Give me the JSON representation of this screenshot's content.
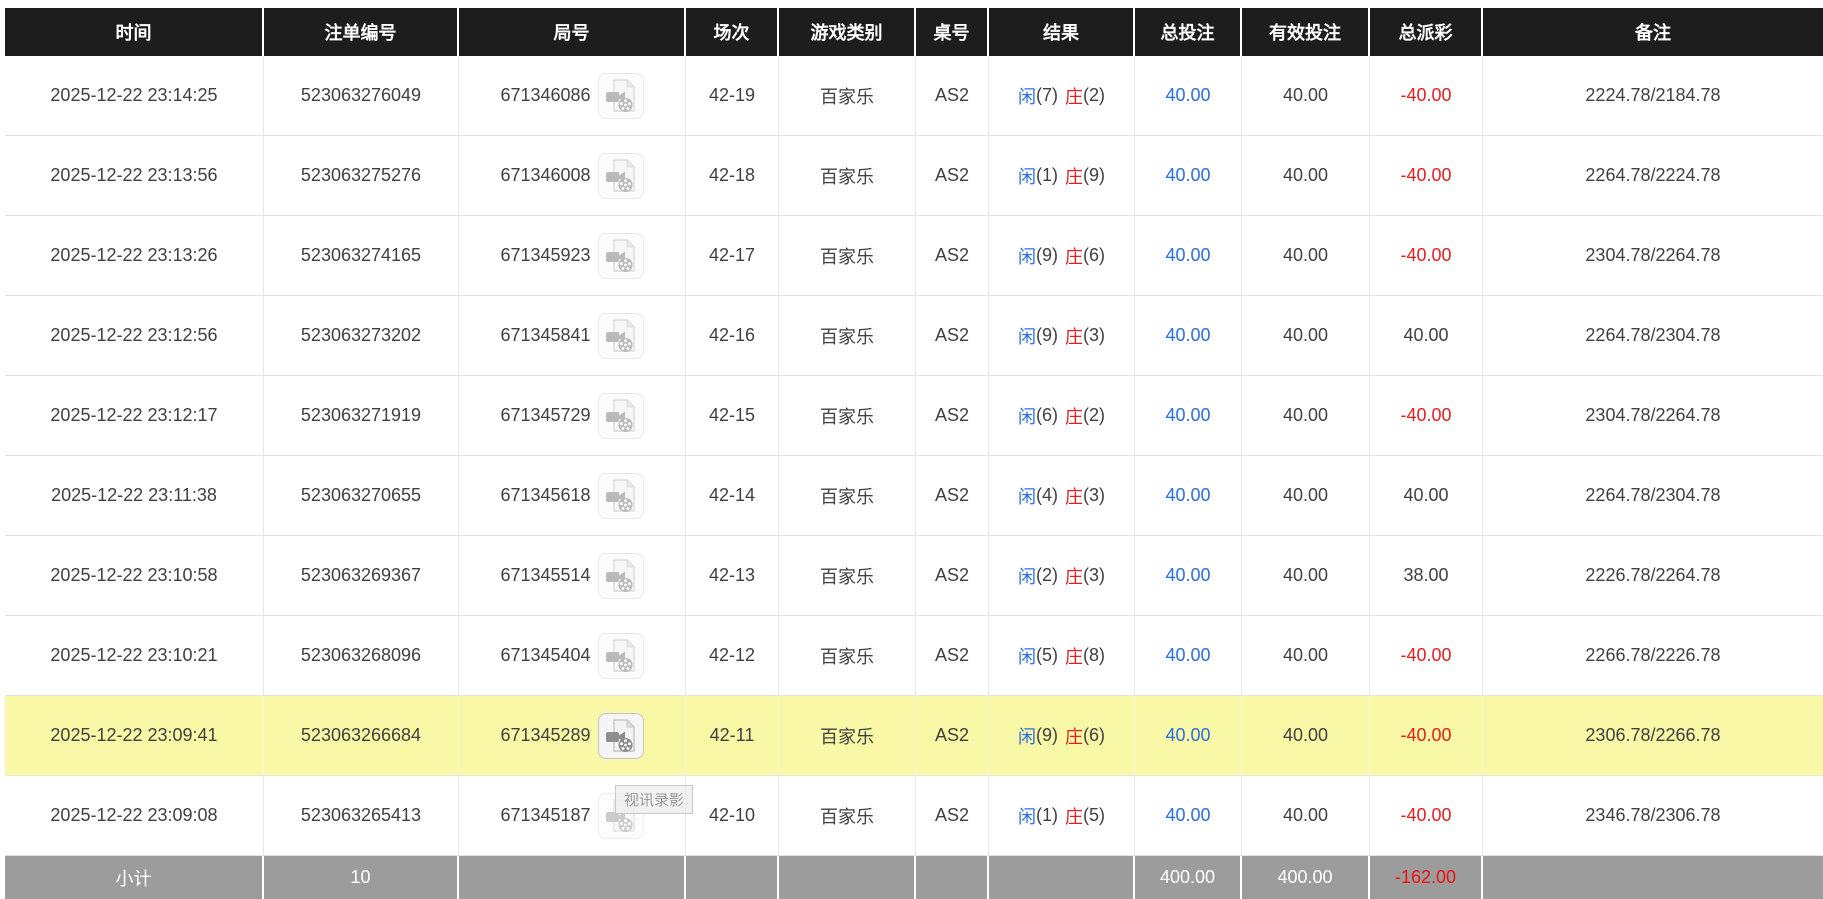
{
  "colors": {
    "header_bg": "#1d1d1d",
    "header_text": "#ffffff",
    "body_text": "#404040",
    "player_blue": "#2b6de0",
    "banker_red": "#dd2020",
    "negative_red": "#dd2020",
    "amount_blue": "#2b6de0",
    "highlight_yellow": "#f8f8a6",
    "footer_bg": "#9c9c9c",
    "row_border": "#e3e3e3"
  },
  "table": {
    "columns": [
      {
        "key": "time",
        "label": "时间"
      },
      {
        "key": "bet_id",
        "label": "注单编号"
      },
      {
        "key": "round_id",
        "label": "局号"
      },
      {
        "key": "session",
        "label": "场次"
      },
      {
        "key": "game_type",
        "label": "游戏类别"
      },
      {
        "key": "table_no",
        "label": "桌号"
      },
      {
        "key": "result",
        "label": "结果"
      },
      {
        "key": "total_bet",
        "label": "总投注"
      },
      {
        "key": "valid_bet",
        "label": "有效投注"
      },
      {
        "key": "payout",
        "label": "总派彩"
      },
      {
        "key": "remark",
        "label": "备注"
      }
    ],
    "rows": [
      {
        "time": "2025-12-22 23:14:25",
        "bet_id": "523063276049",
        "round_id": "671346086",
        "session": "42-19",
        "game_type": "百家乐",
        "table_no": "AS2",
        "result": {
          "player_label": "闲",
          "player_score": "(7)",
          "banker_label": "庄",
          "banker_score": "(2)"
        },
        "total_bet": "40.00",
        "valid_bet": "40.00",
        "payout": "-40.00",
        "remark": "2224.78/2184.78",
        "highlighted": false,
        "show_tooltip": false
      },
      {
        "time": "2025-12-22 23:13:56",
        "bet_id": "523063275276",
        "round_id": "671346008",
        "session": "42-18",
        "game_type": "百家乐",
        "table_no": "AS2",
        "result": {
          "player_label": "闲",
          "player_score": "(1)",
          "banker_label": "庄",
          "banker_score": "(9)"
        },
        "total_bet": "40.00",
        "valid_bet": "40.00",
        "payout": "-40.00",
        "remark": "2264.78/2224.78",
        "highlighted": false,
        "show_tooltip": false
      },
      {
        "time": "2025-12-22 23:13:26",
        "bet_id": "523063274165",
        "round_id": "671345923",
        "session": "42-17",
        "game_type": "百家乐",
        "table_no": "AS2",
        "result": {
          "player_label": "闲",
          "player_score": "(9)",
          "banker_label": "庄",
          "banker_score": "(6)"
        },
        "total_bet": "40.00",
        "valid_bet": "40.00",
        "payout": "-40.00",
        "remark": "2304.78/2264.78",
        "highlighted": false,
        "show_tooltip": false
      },
      {
        "time": "2025-12-22 23:12:56",
        "bet_id": "523063273202",
        "round_id": "671345841",
        "session": "42-16",
        "game_type": "百家乐",
        "table_no": "AS2",
        "result": {
          "player_label": "闲",
          "player_score": "(9)",
          "banker_label": "庄",
          "banker_score": "(3)"
        },
        "total_bet": "40.00",
        "valid_bet": "40.00",
        "payout": "40.00",
        "remark": "2264.78/2304.78",
        "highlighted": false,
        "show_tooltip": false
      },
      {
        "time": "2025-12-22 23:12:17",
        "bet_id": "523063271919",
        "round_id": "671345729",
        "session": "42-15",
        "game_type": "百家乐",
        "table_no": "AS2",
        "result": {
          "player_label": "闲",
          "player_score": "(6)",
          "banker_label": "庄",
          "banker_score": "(2)"
        },
        "total_bet": "40.00",
        "valid_bet": "40.00",
        "payout": "-40.00",
        "remark": "2304.78/2264.78",
        "highlighted": false,
        "show_tooltip": false
      },
      {
        "time": "2025-12-22 23:11:38",
        "bet_id": "523063270655",
        "round_id": "671345618",
        "session": "42-14",
        "game_type": "百家乐",
        "table_no": "AS2",
        "result": {
          "player_label": "闲",
          "player_score": "(4)",
          "banker_label": "庄",
          "banker_score": "(3)"
        },
        "total_bet": "40.00",
        "valid_bet": "40.00",
        "payout": "40.00",
        "remark": "2264.78/2304.78",
        "highlighted": false,
        "show_tooltip": false
      },
      {
        "time": "2025-12-22 23:10:58",
        "bet_id": "523063269367",
        "round_id": "671345514",
        "session": "42-13",
        "game_type": "百家乐",
        "table_no": "AS2",
        "result": {
          "player_label": "闲",
          "player_score": "(2)",
          "banker_label": "庄",
          "banker_score": "(3)"
        },
        "total_bet": "40.00",
        "valid_bet": "40.00",
        "payout": "38.00",
        "remark": "2226.78/2264.78",
        "highlighted": false,
        "show_tooltip": false
      },
      {
        "time": "2025-12-22 23:10:21",
        "bet_id": "523063268096",
        "round_id": "671345404",
        "session": "42-12",
        "game_type": "百家乐",
        "table_no": "AS2",
        "result": {
          "player_label": "闲",
          "player_score": "(5)",
          "banker_label": "庄",
          "banker_score": "(8)"
        },
        "total_bet": "40.00",
        "valid_bet": "40.00",
        "payout": "-40.00",
        "remark": "2266.78/2226.78",
        "highlighted": false,
        "show_tooltip": false
      },
      {
        "time": "2025-12-22 23:09:41",
        "bet_id": "523063266684",
        "round_id": "671345289",
        "session": "42-11",
        "game_type": "百家乐",
        "table_no": "AS2",
        "result": {
          "player_label": "闲",
          "player_score": "(9)",
          "banker_label": "庄",
          "banker_score": "(6)"
        },
        "total_bet": "40.00",
        "valid_bet": "40.00",
        "payout": "-40.00",
        "remark": "2306.78/2266.78",
        "highlighted": true,
        "show_tooltip": false
      },
      {
        "time": "2025-12-22 23:09:08",
        "bet_id": "523063265413",
        "round_id": "671345187",
        "session": "42-10",
        "game_type": "百家乐",
        "table_no": "AS2",
        "result": {
          "player_label": "闲",
          "player_score": "(1)",
          "banker_label": "庄",
          "banker_score": "(5)"
        },
        "total_bet": "40.00",
        "valid_bet": "40.00",
        "payout": "-40.00",
        "remark": "2346.78/2306.78",
        "highlighted": false,
        "show_tooltip": true
      }
    ],
    "footer": {
      "label": "小计",
      "bet_count": "10",
      "total_bet": "400.00",
      "valid_bet": "400.00",
      "total_payout": "-162.00"
    }
  },
  "tooltip": {
    "text": "视讯录影"
  }
}
